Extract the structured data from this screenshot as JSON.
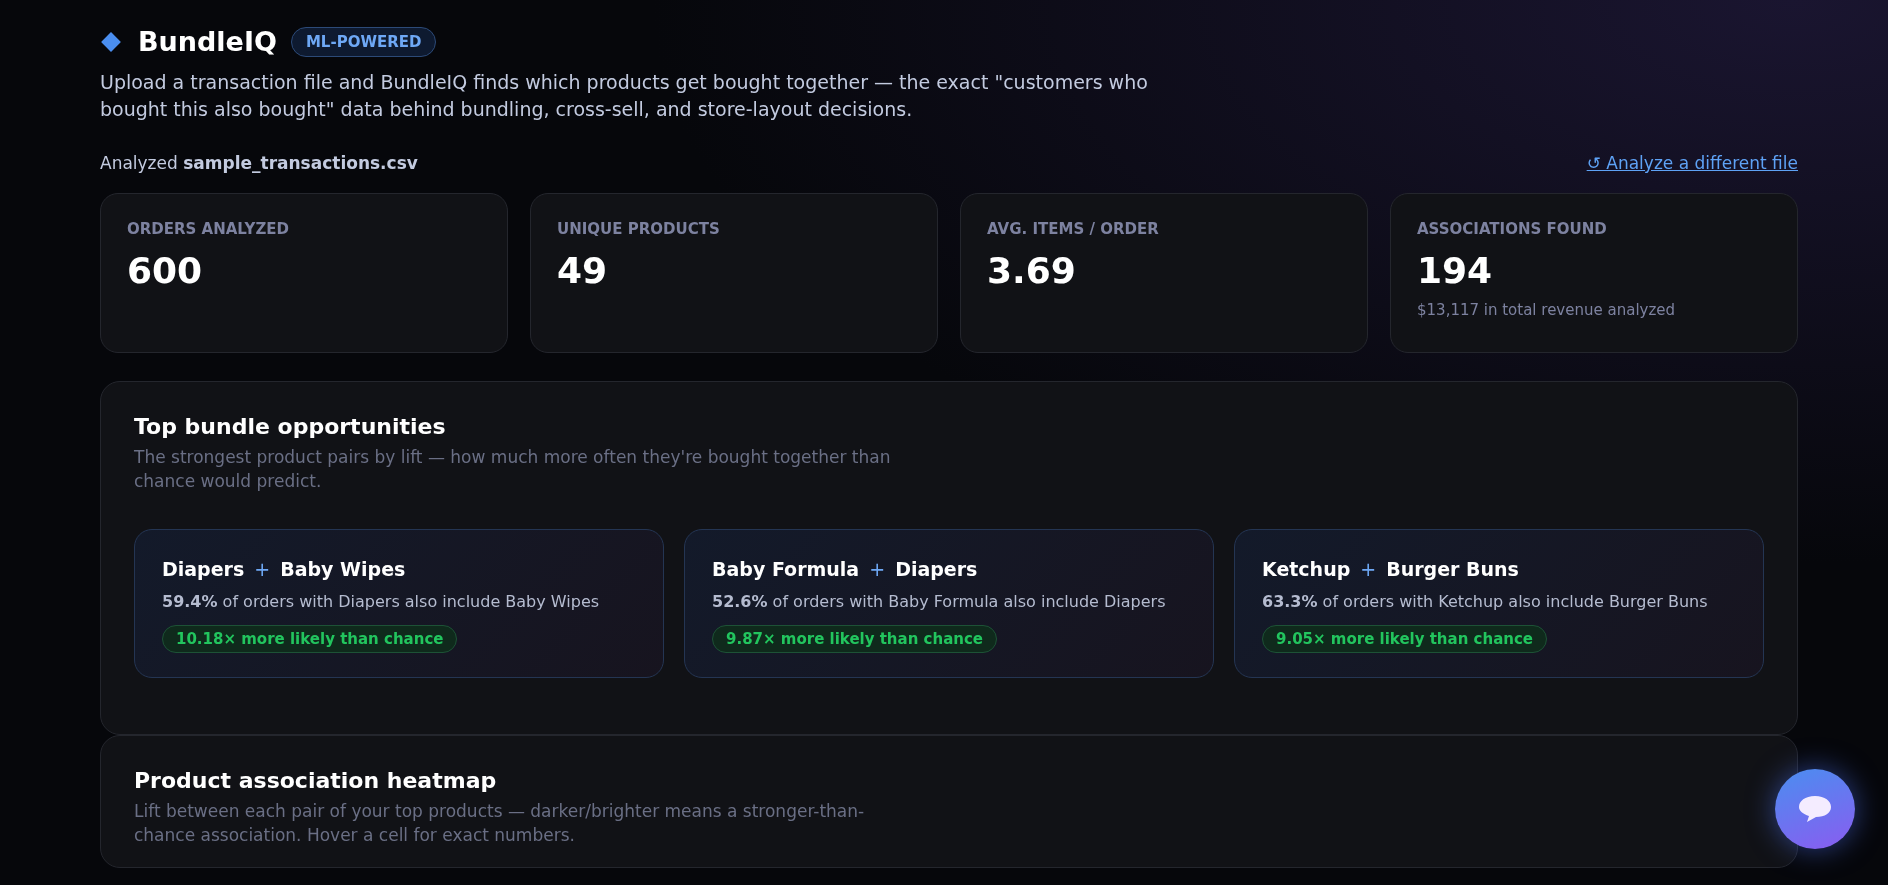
{
  "header": {
    "app_name": "BundleIQ",
    "badge": "ML-POWERED",
    "description": "Upload a transaction file and BundleIQ finds which products get bought together — the exact \"customers who bought this also bought\" data behind bundling, cross-sell, and store-layout decisions."
  },
  "file_bar": {
    "analyzed": "Analyzed **sample_transactions.csv**",
    "link_icon": "↺",
    "link": "Analyze a different file"
  },
  "stats": [
    {
      "label": "ORDERS ANALYZED",
      "value": "600"
    },
    {
      "label": "UNIQUE PRODUCTS",
      "value": "49"
    },
    {
      "label": "AVG. ITEMS / ORDER",
      "value": "3.69"
    },
    {
      "label": "ASSOCIATIONS FOUND",
      "value": "194",
      "note": "$13,117 in total revenue analyzed"
    }
  ],
  "bundles_section": {
    "title": "Top bundle opportunities",
    "subtitle": "The strongest product pairs by lift — how much more often they're bought together than chance would predict.",
    "bundles": [
      {
        "product_a": "Diapers",
        "plus": "+",
        "product_b": "Baby Wipes",
        "description": "**59.4%** of orders with Diapers also include Baby Wipes",
        "lift": "10.18× more likely than chance"
      },
      {
        "product_a": "Baby Formula",
        "plus": "+",
        "product_b": "Diapers",
        "description": "**52.6%** of orders with Baby Formula also include Diapers",
        "lift": "9.87× more likely than chance"
      },
      {
        "product_a": "Ketchup",
        "plus": "+",
        "product_b": "Burger Buns",
        "description": "**63.3%** of orders with Ketchup also include Burger Buns",
        "lift": "9.05× more likely than chance"
      }
    ]
  },
  "heatmap_section": {
    "title": "Product association heatmap",
    "subtitle": "Lift between each pair of your top products — darker/brighter means a stronger-than-chance association. Hover a cell for exact numbers."
  }
}
